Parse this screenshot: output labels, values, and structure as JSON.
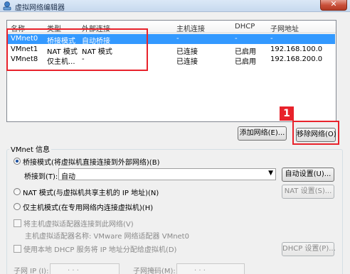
{
  "window": {
    "title": "虚拟网络编辑器",
    "close_symbol": "✕"
  },
  "table": {
    "columns": [
      "名称",
      "类型",
      "外部连接",
      "主机连接",
      "DHCP",
      "子网地址"
    ],
    "rows": [
      {
        "name": "VMnet0",
        "type": "桥接模式",
        "external": "自动桥接",
        "host": "-",
        "dhcp": "-",
        "subnet": "-"
      },
      {
        "name": "VMnet1",
        "type": "NAT 模式",
        "external": "NAT 模式",
        "host": "已连接",
        "dhcp": "已启用",
        "subnet": "192.168.100.0"
      },
      {
        "name": "VMnet8",
        "type": "仅主机...",
        "external": "-",
        "host": "已连接",
        "dhcp": "已启用",
        "subnet": "192.168.200.0"
      }
    ]
  },
  "buttons": {
    "add_network": "添加网络(E)...",
    "remove_network": "移除网络(O)",
    "auto_settings": "自动设置(U)...",
    "nat_settings": "NAT 设置(S)...",
    "dhcp_settings": "DHCP 设置(P)..."
  },
  "annotation": {
    "step": "1"
  },
  "vmnet_info": {
    "group_title": "VMnet 信息",
    "bridged_label": "桥接模式(将虚拟机直接连接到外部网络)(B)",
    "bridged_to_label": "桥接到(T):",
    "bridged_to_value": "自动",
    "nat_label": "NAT 模式(与虚拟机共享主机的 IP 地址)(N)",
    "hostonly_label": "仅主机模式(在专用网络内连接虚拟机)(H)",
    "connect_adapter_label": "将主机虚拟适配器连接到此网络(V)",
    "adapter_name_label": "主机虚拟适配器名称: VMware 网络适配器 VMnet0",
    "use_dhcp_label": "使用本地 DHCP 服务将 IP 地址分配给虚拟机(D)",
    "subnet_ip_label": "子网 IP (I):",
    "subnet_mask_label": "子网掩码(M):",
    "ip_placeholder": ".   .   ."
  }
}
